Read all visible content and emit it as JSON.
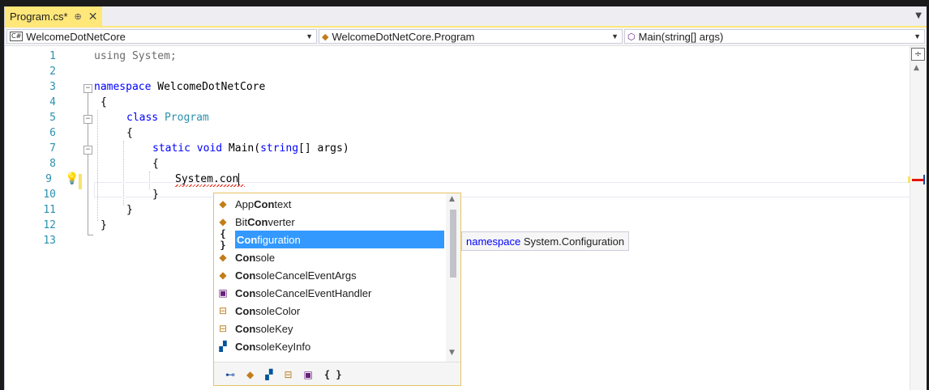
{
  "tab": {
    "title": "Program.cs*",
    "pin": "⊕",
    "close": "✕"
  },
  "nav": {
    "project": "WelcomeDotNetCore",
    "type": "WelcomeDotNetCore.Program",
    "member": "Main(string[] args)"
  },
  "editor": {
    "lines": [
      "1",
      "2",
      "3",
      "4",
      "5",
      "6",
      "7",
      "8",
      "9",
      "10",
      "11",
      "12",
      "13"
    ],
    "code": {
      "l1_kw": "using",
      "l1_rest": " System;",
      "l3_kw": "namespace",
      "l3_rest": " WelcomeDotNetCore",
      "l4": "{",
      "l5_kw": "class",
      "l5_ty": " Program",
      "l6": "{",
      "l7_kw1": "static",
      "l7_kw2": " void",
      "l7_name": " Main(",
      "l7_kw3": "string",
      "l7_rest": "[] args)",
      "l8": "{",
      "l9_a": "System.",
      "l9_b": "con",
      "l10": "}",
      "l11": "}",
      "l12": "}"
    }
  },
  "completion": {
    "items": [
      {
        "icon": "class-icon",
        "glyph": "◆",
        "bold": "",
        "pre": "App",
        "match": "Con",
        "post": "text"
      },
      {
        "icon": "class-icon",
        "glyph": "◆",
        "pre": "Bit",
        "match": "Con",
        "post": "verter"
      },
      {
        "icon": "namespace-icon",
        "glyph": "{ }",
        "pre": "",
        "match": "Con",
        "post": "figuration"
      },
      {
        "icon": "class-icon",
        "glyph": "◆",
        "pre": "",
        "match": "Con",
        "post": "sole"
      },
      {
        "icon": "class-icon",
        "glyph": "◆",
        "pre": "",
        "match": "Con",
        "post": "soleCancelEventArgs"
      },
      {
        "icon": "delegate-icon",
        "glyph": "▣",
        "pre": "",
        "match": "Con",
        "post": "soleCancelEventHandler"
      },
      {
        "icon": "enum-icon",
        "glyph": "⊟",
        "pre": "",
        "match": "Con",
        "post": "soleColor"
      },
      {
        "icon": "enum-icon",
        "glyph": "⊟",
        "pre": "",
        "match": "Con",
        "post": "soleKey"
      },
      {
        "icon": "struct-icon",
        "glyph": "▞",
        "pre": "",
        "match": "Con",
        "post": "soleKeyInfo"
      }
    ],
    "selected_index": 2,
    "filters": [
      "⊷",
      "◆",
      "▞",
      "⊟",
      "▣",
      "{ }"
    ]
  },
  "tooltip": {
    "kw": "namespace",
    "text": " System.Configuration"
  },
  "colors": {
    "accent": "#ffe77a",
    "selection": "#3399ff",
    "keyword": "#0000ff",
    "type": "#2b91af",
    "linenum": "#2b91af"
  }
}
